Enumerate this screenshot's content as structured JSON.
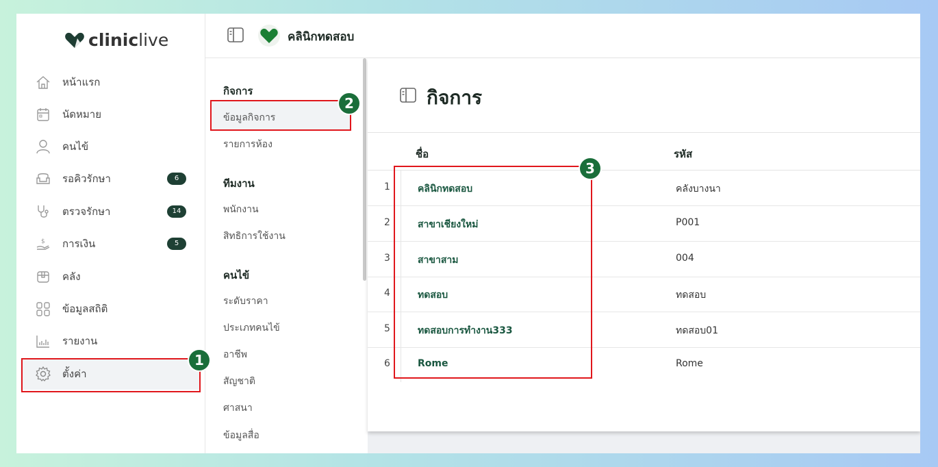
{
  "brand": {
    "logo_part1": "clinic",
    "logo_part2": "live"
  },
  "topbar": {
    "clinic_name": "คลินิกทดสอบ"
  },
  "sidebar": {
    "items": [
      {
        "label": "หน้าแรก",
        "icon": "home-icon"
      },
      {
        "label": "นัดหมาย",
        "icon": "calendar-icon"
      },
      {
        "label": "คนไข้",
        "icon": "user-icon"
      },
      {
        "label": "รอคิวรักษา",
        "icon": "seat-icon",
        "badge": "6"
      },
      {
        "label": "ตรวจรักษา",
        "icon": "stethoscope-icon",
        "badge": "14"
      },
      {
        "label": "การเงิน",
        "icon": "money-hand-icon",
        "badge": "5"
      },
      {
        "label": "คลัง",
        "icon": "box-icon"
      },
      {
        "label": "ข้อมูลสถิติ",
        "icon": "grid-icon"
      },
      {
        "label": "รายงาน",
        "icon": "report-icon"
      },
      {
        "label": "ตั้งค่า",
        "icon": "gear-icon"
      }
    ]
  },
  "submenu": {
    "sections": [
      {
        "title": "กิจการ",
        "items": [
          "ข้อมูลกิจการ",
          "รายการห้อง"
        ]
      },
      {
        "title": "ทีมงาน",
        "items": [
          "พนักงาน",
          "สิทธิการใช้งาน"
        ]
      },
      {
        "title": "คนไข้",
        "items": [
          "ระดับราคา",
          "ประเภทคนไข้",
          "อาชีพ",
          "สัญชาติ",
          "ศาสนา",
          "ข้อมูลสื่อ"
        ]
      }
    ]
  },
  "main": {
    "title": "กิจการ",
    "columns": {
      "name": "ชื่อ",
      "code": "รหัส"
    },
    "rows": [
      {
        "index": "1",
        "name": "คลินิกทดสอบ",
        "code": "คลังบางนา"
      },
      {
        "index": "2",
        "name": "สาขาเชียงใหม่",
        "code": "P001"
      },
      {
        "index": "3",
        "name": "สาขาสาม",
        "code": "004"
      },
      {
        "index": "4",
        "name": "ทดสอบ",
        "code": "ทดสอบ"
      },
      {
        "index": "5",
        "name": "ทดสอบการทำงาน333",
        "code": "ทดสอบ01"
      },
      {
        "index": "6",
        "name": "Rome",
        "code": "Rome"
      }
    ]
  },
  "annotations": {
    "marker1": "1",
    "marker2": "2",
    "marker3": "3"
  },
  "colors": {
    "brand_green": "#1a6e3a",
    "badge_bg": "#1e4034",
    "highlight_red": "#e0161b"
  }
}
